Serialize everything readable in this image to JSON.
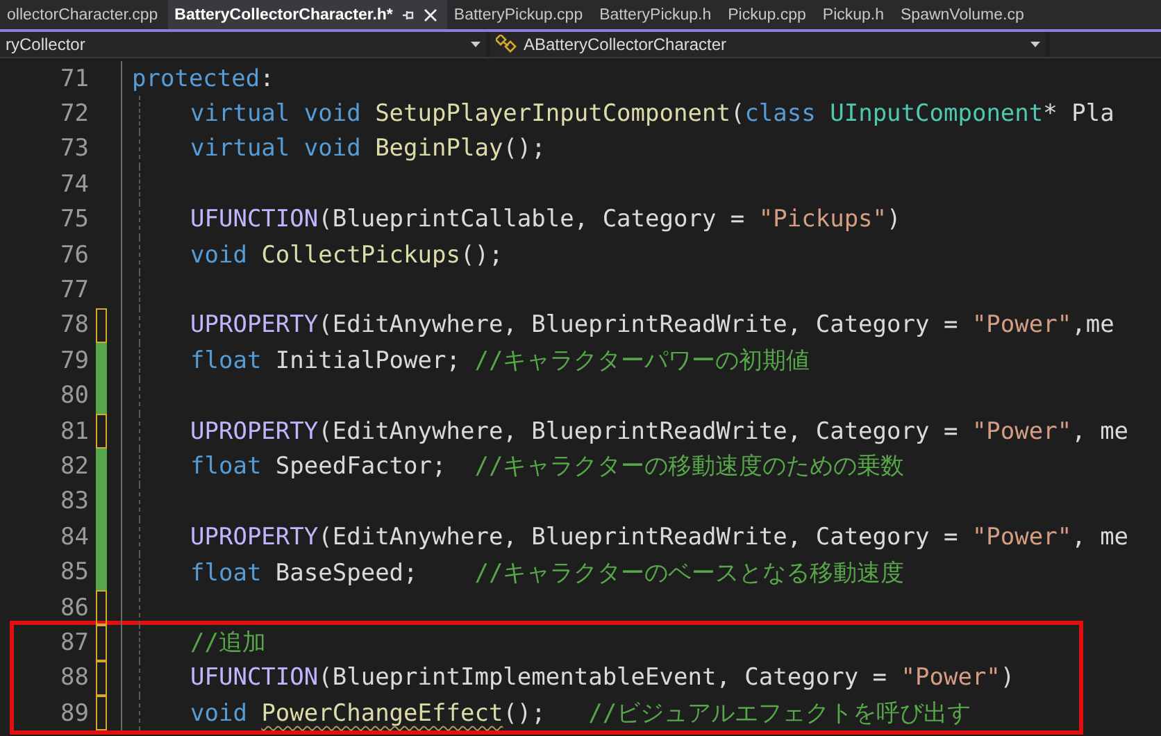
{
  "tabs": [
    {
      "label": "ollectorCharacter.cpp",
      "selected": false
    },
    {
      "label": "BatteryCollectorCharacter.h*",
      "selected": true
    },
    {
      "label": "BatteryPickup.cpp",
      "selected": false
    },
    {
      "label": "BatteryPickup.h",
      "selected": false
    },
    {
      "label": "Pickup.cpp",
      "selected": false
    },
    {
      "label": "Pickup.h",
      "selected": false
    },
    {
      "label": "SpawnVolume.cp",
      "selected": false
    }
  ],
  "navigation_bar": {
    "project": "ryCollector",
    "scope": "ABatteryCollectorCharacter"
  },
  "editor": {
    "lines": [
      {
        "number": "71",
        "indented": false,
        "highlighted": false,
        "tokens": [
          {
            "text": "protected",
            "kind": "kw"
          },
          {
            "text": ":",
            "kind": "plain"
          }
        ]
      },
      {
        "number": "72",
        "indented": true,
        "highlighted": false,
        "tokens": [
          {
            "text": "virtual void ",
            "kind": "kw"
          },
          {
            "text": "SetupPlayerInputComponent",
            "kind": "fn"
          },
          {
            "text": "(",
            "kind": "plain"
          },
          {
            "text": "class ",
            "kind": "kw"
          },
          {
            "text": "UInputComponent",
            "kind": "type"
          },
          {
            "text": "* Pla",
            "kind": "plain"
          }
        ]
      },
      {
        "number": "73",
        "indented": true,
        "highlighted": false,
        "tokens": [
          {
            "text": "virtual void ",
            "kind": "kw"
          },
          {
            "text": "BeginPlay",
            "kind": "fn"
          },
          {
            "text": "();",
            "kind": "plain"
          }
        ]
      },
      {
        "number": "74",
        "indented": true,
        "highlighted": false
      },
      {
        "number": "75",
        "indented": true,
        "highlighted": false,
        "tokens": [
          {
            "text": "UFUNCTION",
            "kind": "macro"
          },
          {
            "text": "(BlueprintCallable, Category = ",
            "kind": "plain"
          },
          {
            "text": "\"Pickups\"",
            "kind": "str"
          },
          {
            "text": ")",
            "kind": "plain"
          }
        ]
      },
      {
        "number": "76",
        "indented": true,
        "highlighted": false,
        "tokens": [
          {
            "text": "void ",
            "kind": "kw"
          },
          {
            "text": "CollectPickups",
            "kind": "fn"
          },
          {
            "text": "();",
            "kind": "plain"
          }
        ]
      },
      {
        "number": "77",
        "indented": true,
        "highlighted": false
      },
      {
        "number": "78",
        "change_saved": false,
        "indented": true,
        "highlighted": false,
        "tokens": [
          {
            "text": "UPROPERTY",
            "kind": "macro"
          },
          {
            "text": "(EditAnywhere, BlueprintReadWrite, Category = ",
            "kind": "plain"
          },
          {
            "text": "\"Power\"",
            "kind": "str"
          },
          {
            "text": ",me",
            "kind": "plain"
          }
        ]
      },
      {
        "number": "79",
        "change_saved": true,
        "indented": true,
        "highlighted": false,
        "tokens": [
          {
            "text": "float",
            "kind": "kw"
          },
          {
            "text": " InitialPower; ",
            "kind": "plain"
          },
          {
            "text": "//キャラクターパワーの初期値",
            "kind": "cm"
          }
        ]
      },
      {
        "number": "80",
        "change_saved": true,
        "indented": true,
        "highlighted": false
      },
      {
        "number": "81",
        "change_saved": false,
        "indented": true,
        "highlighted": false,
        "tokens": [
          {
            "text": "UPROPERTY",
            "kind": "macro"
          },
          {
            "text": "(EditAnywhere, BlueprintReadWrite, Category = ",
            "kind": "plain"
          },
          {
            "text": "\"Power\"",
            "kind": "str"
          },
          {
            "text": ", me",
            "kind": "plain"
          }
        ]
      },
      {
        "number": "82",
        "change_saved": true,
        "indented": true,
        "highlighted": false,
        "tokens": [
          {
            "text": "float",
            "kind": "kw"
          },
          {
            "text": " SpeedFactor;  ",
            "kind": "plain"
          },
          {
            "text": "//キャラクターの移動速度のための乗数",
            "kind": "cm"
          }
        ]
      },
      {
        "number": "83",
        "change_saved": true,
        "indented": true,
        "highlighted": false
      },
      {
        "number": "84",
        "change_saved": true,
        "indented": true,
        "highlighted": false,
        "tokens": [
          {
            "text": "UPROPERTY",
            "kind": "macro"
          },
          {
            "text": "(EditAnywhere, BlueprintReadWrite, Category = ",
            "kind": "plain"
          },
          {
            "text": "\"Power\"",
            "kind": "str"
          },
          {
            "text": ", me",
            "kind": "plain"
          }
        ]
      },
      {
        "number": "85",
        "change_saved": true,
        "indented": true,
        "highlighted": false,
        "tokens": [
          {
            "text": "float",
            "kind": "kw"
          },
          {
            "text": " BaseSpeed;    ",
            "kind": "plain"
          },
          {
            "text": "//キャラクターのベースとなる移動速度",
            "kind": "cm"
          }
        ]
      },
      {
        "number": "86",
        "change_saved": false,
        "indented": true,
        "highlighted": false
      },
      {
        "number": "87",
        "change_saved": false,
        "indented": true,
        "highlighted": true,
        "tokens": [
          {
            "text": "//追加",
            "kind": "cm"
          }
        ]
      },
      {
        "number": "88",
        "change_saved": false,
        "indented": true,
        "highlighted": true,
        "tokens": [
          {
            "text": "UFUNCTION",
            "kind": "macro"
          },
          {
            "text": "(BlueprintImplementableEvent, Category = ",
            "kind": "plain"
          },
          {
            "text": "\"Power\"",
            "kind": "str"
          },
          {
            "text": ")",
            "kind": "plain"
          }
        ]
      },
      {
        "number": "89",
        "change_saved": false,
        "indented": true,
        "highlighted": true,
        "tokens": [
          {
            "text": "void ",
            "kind": "kw"
          },
          {
            "text": "PowerChangeEffect",
            "kind": "fn",
            "error": true
          },
          {
            "text": "();   ",
            "kind": "plain"
          },
          {
            "text": "//ビジュアルエフェクトを呼び出す",
            "kind": "cm"
          }
        ]
      }
    ]
  }
}
